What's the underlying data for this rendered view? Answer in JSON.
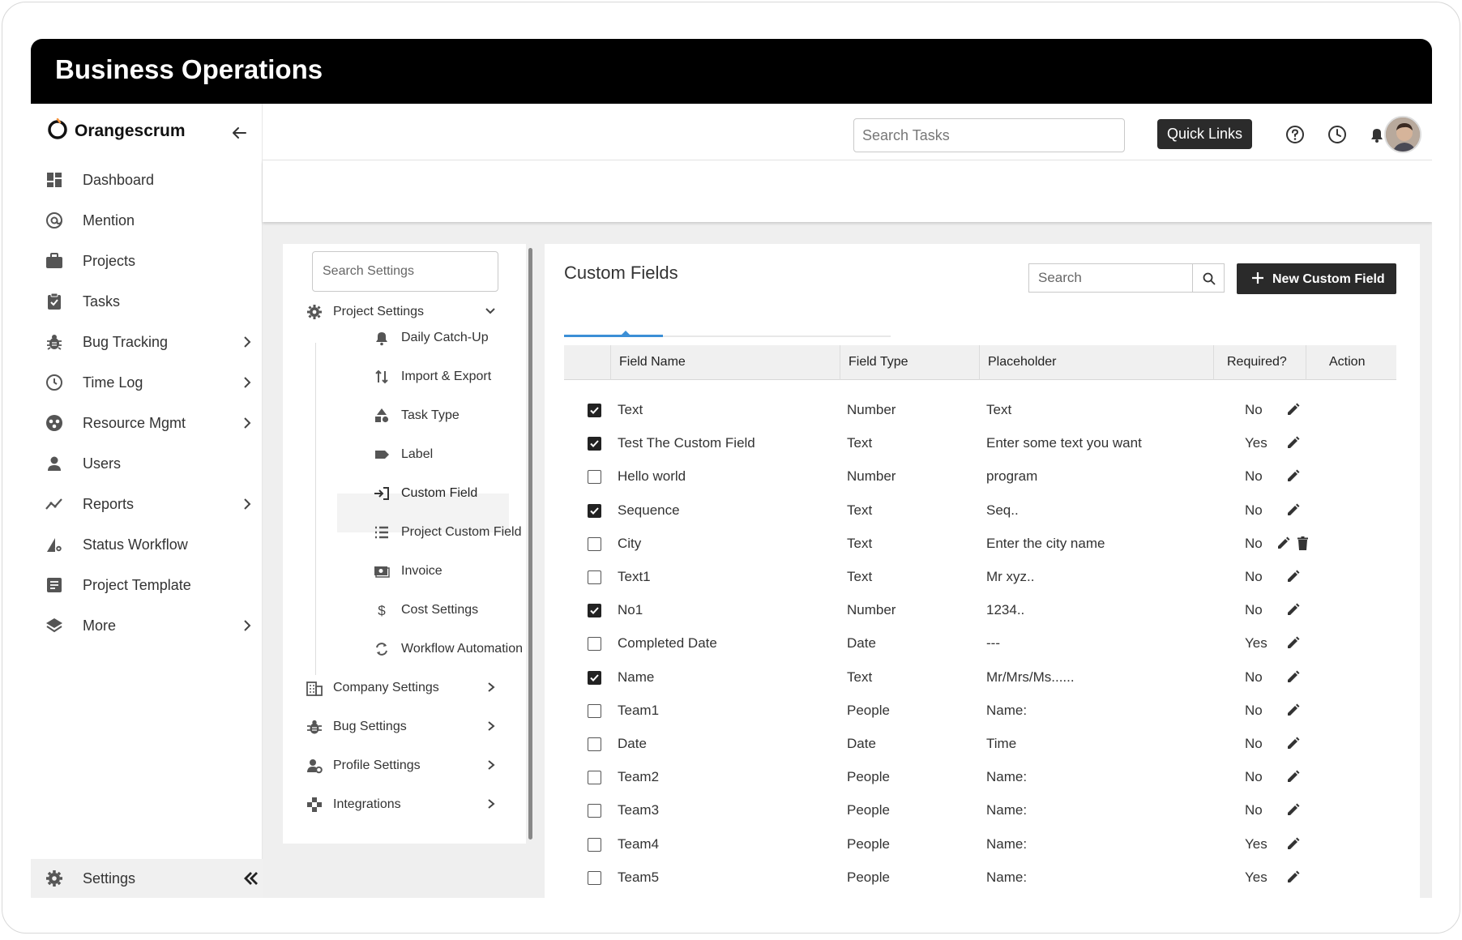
{
  "window": {
    "title": "Business Operations"
  },
  "brand": {
    "name": "Orangescrum"
  },
  "topbar": {
    "search_placeholder": "Search Tasks",
    "quick_links_label": "Quick Links",
    "icons": [
      "help-icon",
      "clock-icon",
      "bell-icon",
      "avatar"
    ]
  },
  "sidebar": {
    "items": [
      {
        "label": "Dashboard",
        "icon": "dashboard-icon",
        "has_submenu": false
      },
      {
        "label": "Mention",
        "icon": "at-icon",
        "has_submenu": false
      },
      {
        "label": "Projects",
        "icon": "briefcase-icon",
        "has_submenu": false
      },
      {
        "label": "Tasks",
        "icon": "clipboard-check-icon",
        "has_submenu": false
      },
      {
        "label": "Bug Tracking",
        "icon": "bug-icon",
        "has_submenu": true
      },
      {
        "label": "Time Log",
        "icon": "clock-icon",
        "has_submenu": true
      },
      {
        "label": "Resource Mgmt",
        "icon": "resource-icon",
        "has_submenu": true
      },
      {
        "label": "Users",
        "icon": "user-icon",
        "has_submenu": false
      },
      {
        "label": "Reports",
        "icon": "trend-icon",
        "has_submenu": true
      },
      {
        "label": "Status Workflow",
        "icon": "workflow-icon",
        "has_submenu": false
      },
      {
        "label": "Project Template",
        "icon": "template-icon",
        "has_submenu": false
      },
      {
        "label": "More",
        "icon": "layers-icon",
        "has_submenu": true
      }
    ],
    "settings_label": "Settings"
  },
  "settings_panel": {
    "search_placeholder": "Search Settings",
    "project_settings_label": "Project Settings",
    "sub_items": [
      {
        "label": "Daily Catch-Up",
        "icon": "bell-icon"
      },
      {
        "label": "Import & Export",
        "icon": "import-export-icon"
      },
      {
        "label": "Task Type",
        "icon": "shapes-icon"
      },
      {
        "label": "Label",
        "icon": "label-icon"
      },
      {
        "label": "Custom Field",
        "icon": "field-input-icon",
        "active": true
      },
      {
        "label": "Project Custom Field",
        "icon": "list-icon"
      },
      {
        "label": "Invoice",
        "icon": "invoice-icon"
      },
      {
        "label": "Cost Settings",
        "icon": "dollar-icon"
      },
      {
        "label": "Workflow Automation",
        "icon": "sync-icon"
      }
    ],
    "groups": [
      {
        "label": "Company Settings",
        "icon": "building-icon"
      },
      {
        "label": "Bug Settings",
        "icon": "bug-icon"
      },
      {
        "label": "Profile Settings",
        "icon": "user-gear-icon"
      },
      {
        "label": "Integrations",
        "icon": "integrations-icon"
      }
    ]
  },
  "custom_fields": {
    "title": "Custom Fields",
    "search_placeholder": "Search",
    "new_button_label": "New Custom Field",
    "columns": [
      "Field Name",
      "Field Type",
      "Placeholder",
      "Required?",
      "Action"
    ],
    "rows": [
      {
        "checked": true,
        "name": "Text",
        "type": "Number",
        "placeholder": "Text",
        "required": "No",
        "deletable": false
      },
      {
        "checked": true,
        "name": "Test The Custom Field",
        "type": "Text",
        "placeholder": "Enter some text you want",
        "required": "Yes",
        "deletable": false
      },
      {
        "checked": false,
        "name": "Hello world",
        "type": "Number",
        "placeholder": "program",
        "required": "No",
        "deletable": false
      },
      {
        "checked": true,
        "name": "Sequence",
        "type": "Text",
        "placeholder": "Seq..",
        "required": "No",
        "deletable": false
      },
      {
        "checked": false,
        "name": "City",
        "type": "Text",
        "placeholder": "Enter the city name",
        "required": "No",
        "deletable": true
      },
      {
        "checked": false,
        "name": "Text1",
        "type": "Text",
        "placeholder": "Mr xyz..",
        "required": "No",
        "deletable": false
      },
      {
        "checked": true,
        "name": "No1",
        "type": "Number",
        "placeholder": "1234..",
        "required": "No",
        "deletable": false
      },
      {
        "checked": false,
        "name": "Completed Date",
        "type": "Date",
        "placeholder": "---",
        "required": "Yes",
        "deletable": false
      },
      {
        "checked": true,
        "name": "Name",
        "type": "Text",
        "placeholder": "Mr/Mrs/Ms......",
        "required": "No",
        "deletable": false
      },
      {
        "checked": false,
        "name": "Team1",
        "type": "People",
        "placeholder": "Name:",
        "required": "No",
        "deletable": false
      },
      {
        "checked": false,
        "name": "Date",
        "type": "Date",
        "placeholder": "Time",
        "required": "No",
        "deletable": false
      },
      {
        "checked": false,
        "name": "Team2",
        "type": "People",
        "placeholder": "Name:",
        "required": "No",
        "deletable": false
      },
      {
        "checked": false,
        "name": "Team3",
        "type": "People",
        "placeholder": "Name:",
        "required": "No",
        "deletable": false
      },
      {
        "checked": false,
        "name": "Team4",
        "type": "People",
        "placeholder": "Name:",
        "required": "Yes",
        "deletable": false
      },
      {
        "checked": false,
        "name": "Team5",
        "type": "People",
        "placeholder": "Name:",
        "required": "Yes",
        "deletable": false
      }
    ]
  },
  "colors": {
    "accent": "#3c8fd6",
    "chat_button": "#f7943d",
    "dark_button": "#2a2a2a"
  }
}
